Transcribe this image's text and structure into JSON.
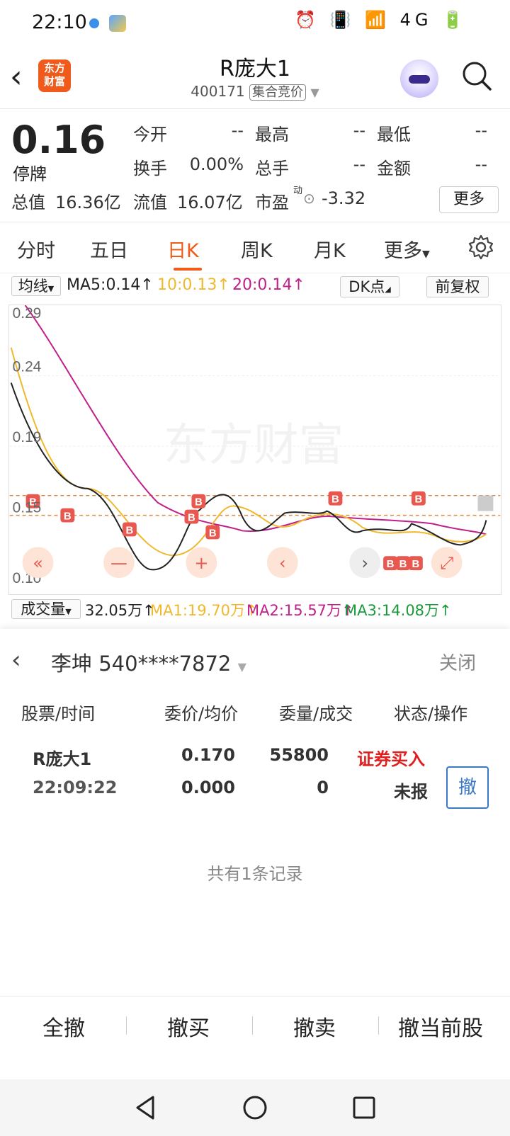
{
  "status_bar": {
    "time": "22:10",
    "right_icons": "⏰ 📳 📶 4G 🔋"
  },
  "header": {
    "title": "R庞大1",
    "code": "400171",
    "tag": "集合竞价",
    "logo_line1": "东方",
    "logo_line2": "财富"
  },
  "quote": {
    "price": "0.16",
    "status": "停牌",
    "open_label": "今开",
    "open_value": "--",
    "high_label": "最高",
    "high_value": "--",
    "low_label": "最低",
    "low_value": "--",
    "turnover_label": "换手",
    "turnover_value": "0.00%",
    "volume_label": "总手",
    "volume_value": "--",
    "amount_label": "金额",
    "amount_value": "--",
    "mcap_label": "总值",
    "mcap_value": "16.36亿",
    "float_label": "流值",
    "float_value": "16.07亿",
    "pe_label": "市盈",
    "pe_sup": "动",
    "pe_value": "-3.32",
    "more": "更多"
  },
  "tabs": [
    "分时",
    "五日",
    "日K",
    "周K",
    "月K",
    "更多"
  ],
  "ma_row": {
    "selector": "均线",
    "ma5": "MA5:0.14↑",
    "ma10": "10:0.13↑",
    "ma20": "20:0.14↑",
    "dk": "DK点",
    "adjust": "前复权"
  },
  "chart": {
    "y_labels": [
      "0.29",
      "0.24",
      "0.19",
      "0.15",
      "0.10"
    ],
    "watermark": "东方财富",
    "colors": {
      "ma5": "#222222",
      "ma10": "#f0b82c",
      "ma20": "#c0208a",
      "marker": "#e8584f",
      "dash": "#d9843a"
    },
    "controls": [
      "«",
      "—",
      "+",
      "‹",
      "›",
      "⤢"
    ]
  },
  "vol_row": {
    "selector": "成交量",
    "vol": "32.05万↑",
    "ma1": "MA1:19.70万↑",
    "ma2": "MA2:15.57万↑",
    "ma3": "MA3:14.08万↑"
  },
  "panel": {
    "account": "李坤 540****7872",
    "close": "关闭",
    "headers": [
      "股票/时间",
      "委价/均价",
      "委量/成交",
      "状态/操作"
    ],
    "order": {
      "name": "R庞大1",
      "time": "22:09:22",
      "price": "0.170",
      "avg": "0.000",
      "qty": "55800",
      "filled": "0",
      "type": "证券买入",
      "state": "未报",
      "cancel": "撤"
    },
    "records": "共有1条记录"
  },
  "bottom_actions": [
    "全撤",
    "撤买",
    "撤卖",
    "撤当前股"
  ]
}
